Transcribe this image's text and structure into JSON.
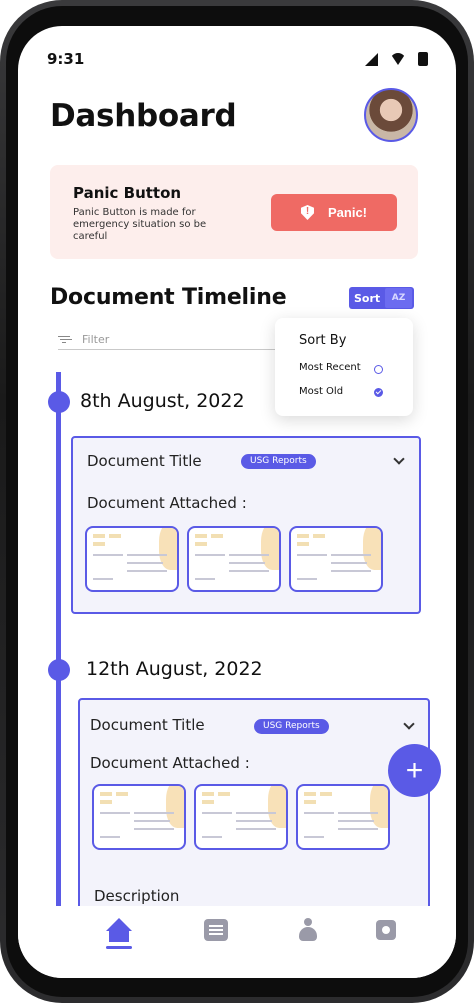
{
  "status": {
    "time": "9:31"
  },
  "header": {
    "title": "Dashboard"
  },
  "panic": {
    "title": "Panic Button",
    "description": "Panic Button is made for emergency situation so be careful",
    "button_label": "Panic!"
  },
  "timeline": {
    "title": "Document Timeline",
    "sort_label": "Sort",
    "sort_az": "AZ",
    "filter_placeholder": "Filter",
    "entries": [
      {
        "date": "8th August, 2022",
        "doc_title": "Document Title",
        "tag": "USG Reports",
        "attached_label": "Document Attached :"
      },
      {
        "date": "12th August, 2022",
        "doc_title": "Document Title",
        "tag": "USG Reports",
        "attached_label": "Document Attached :",
        "description_label": "Description"
      }
    ]
  },
  "sort_popup": {
    "title": "Sort By",
    "options": [
      {
        "label": "Most Recent",
        "selected": false
      },
      {
        "label": "Most Old",
        "selected": true
      }
    ]
  },
  "fab": {
    "label": "+"
  },
  "nav": {
    "items": [
      "home-icon",
      "document-icon",
      "baby-icon",
      "settings-icon"
    ],
    "active": "home-icon"
  },
  "colors": {
    "accent": "#5a5ae6",
    "panic_bg": "#fdeeec",
    "panic_button": "#ef6a64"
  }
}
